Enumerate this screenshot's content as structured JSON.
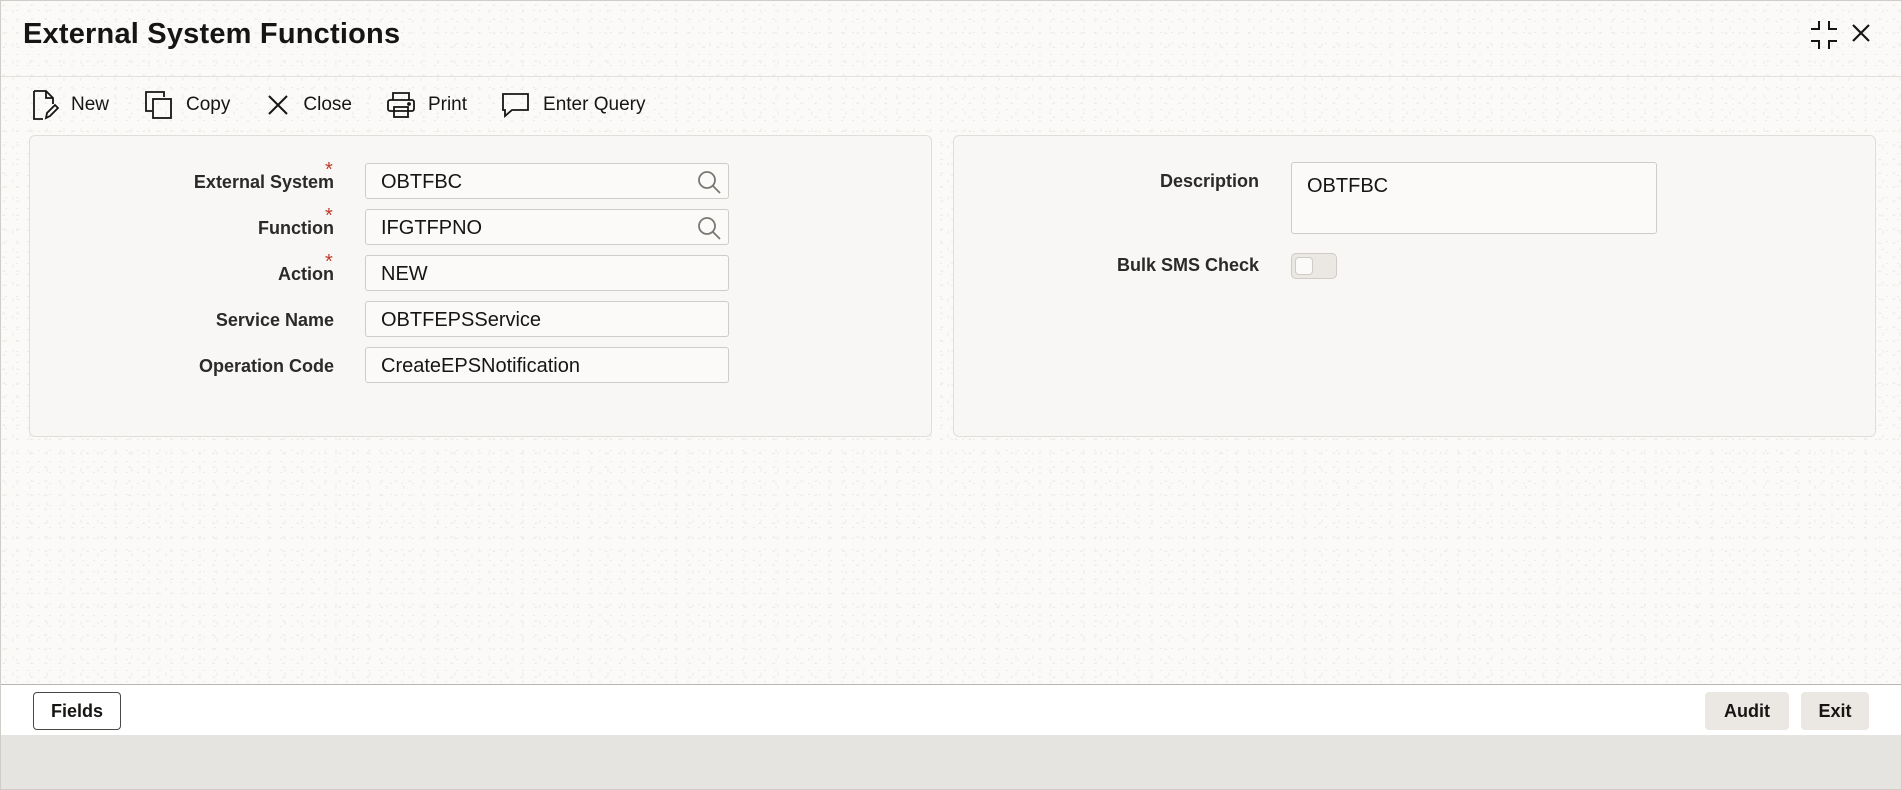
{
  "window": {
    "title": "External System Functions",
    "controls": {
      "maximize_icon": "maximize-icon",
      "close_icon": "close-icon"
    }
  },
  "toolbar": {
    "items": [
      {
        "label": "New",
        "icon": "new-document-icon"
      },
      {
        "label": "Copy",
        "icon": "copy-icon"
      },
      {
        "label": "Close",
        "icon": "close-icon"
      },
      {
        "label": "Print",
        "icon": "printer-icon"
      },
      {
        "label": "Enter Query",
        "icon": "chat-bubble-icon"
      }
    ]
  },
  "form_left": {
    "external_system": {
      "label": "External System",
      "required_mark": "*",
      "value": "OBTFBC"
    },
    "function": {
      "label": "Function",
      "required_mark": "*",
      "value": "IFGTFPNO"
    },
    "action": {
      "label": "Action",
      "required_mark": "*",
      "value": "NEW"
    },
    "service_name": {
      "label": "Service Name",
      "value": "OBTFEPSService"
    },
    "operation_code": {
      "label": "Operation Code",
      "value": "CreateEPSNotification"
    }
  },
  "form_right": {
    "description": {
      "label": "Description",
      "value": "OBTFBC"
    },
    "bulk_sms_check": {
      "label": "Bulk SMS Check",
      "checked": false
    }
  },
  "footer": {
    "fields_label": "Fields",
    "audit_label": "Audit",
    "exit_label": "Exit"
  },
  "colors": {
    "required": "#c0392b",
    "panel_bg": "#f8f7f5",
    "button_bg": "#ebe8e4"
  }
}
